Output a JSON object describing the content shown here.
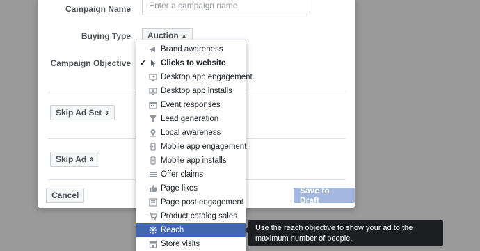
{
  "form": {
    "campaign_name_label": "Campaign Name",
    "campaign_name_placeholder": "Enter a campaign name",
    "buying_type_label": "Buying Type",
    "buying_type_value": "Auction",
    "campaign_objective_label": "Campaign Objective",
    "skip_ad_set_label": "Skip Ad Set",
    "skip_ad_label": "Skip Ad",
    "cancel_label": "Cancel",
    "save_draft_label": "Save to Draft"
  },
  "menu": {
    "selected": "Clicks to website",
    "highlighted": "Reach",
    "items": [
      {
        "label": "Brand awareness",
        "icon": "megaphone-icon"
      },
      {
        "label": "Clicks to website",
        "icon": "cursor-icon"
      },
      {
        "label": "Desktop app engagement",
        "icon": "desktop-app-engagement-icon"
      },
      {
        "label": "Desktop app installs",
        "icon": "desktop-app-install-icon"
      },
      {
        "label": "Event responses",
        "icon": "calendar-icon"
      },
      {
        "label": "Lead generation",
        "icon": "funnel-icon"
      },
      {
        "label": "Local awareness",
        "icon": "location-pin-icon"
      },
      {
        "label": "Mobile app engagement",
        "icon": "mobile-app-engagement-icon"
      },
      {
        "label": "Mobile app installs",
        "icon": "mobile-app-install-icon"
      },
      {
        "label": "Offer claims",
        "icon": "offer-icon"
      },
      {
        "label": "Page likes",
        "icon": "thumbs-up-icon"
      },
      {
        "label": "Page post engagement",
        "icon": "post-engagement-icon"
      },
      {
        "label": "Product catalog sales",
        "icon": "shopping-cart-icon"
      },
      {
        "label": "Reach",
        "icon": "reach-icon"
      },
      {
        "label": "Store visits",
        "icon": "store-icon"
      }
    ]
  },
  "tooltip": {
    "text": "Use the reach objective to show your ad to the maximum number of people."
  },
  "colors": {
    "highlight": "#4267b2",
    "primary_disabled": "#a3b7e0",
    "overlay": "#9a9a9a"
  }
}
